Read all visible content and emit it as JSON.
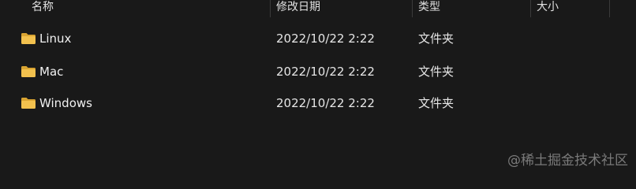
{
  "columns": {
    "name": "名称",
    "modified": "修改日期",
    "type": "类型",
    "size": "大小"
  },
  "rows": [
    {
      "name": "Linux",
      "modified": "2022/10/22 2:22",
      "type": "文件夹",
      "icon": "folder-icon"
    },
    {
      "name": "Mac",
      "modified": "2022/10/22 2:22",
      "type": "文件夹",
      "icon": "folder-icon"
    },
    {
      "name": "Windows",
      "modified": "2022/10/22 2:22",
      "type": "文件夹",
      "icon": "folder-icon"
    }
  ],
  "watermark": "@稀土掘金技术社区",
  "colors": {
    "background": "#191919",
    "folder": "#f2c14e",
    "folder_shade": "#d9a432"
  }
}
